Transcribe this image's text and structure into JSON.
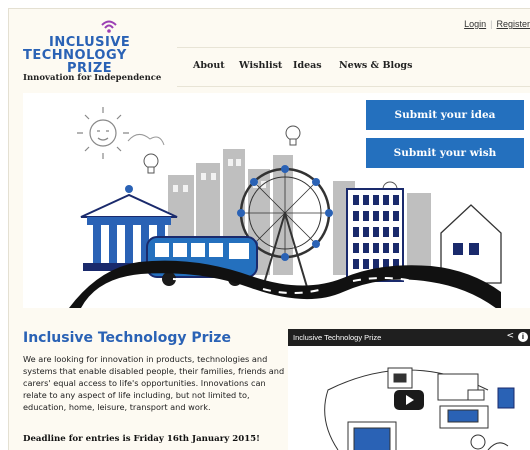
{
  "logo": {
    "line1": "INCLUSIVE",
    "line2": "TECHNOLOGY",
    "line3": "PRIZE",
    "tagline": "Innovation for Independence"
  },
  "account": {
    "login": "Login",
    "register": "Register"
  },
  "nav": {
    "items": [
      "About",
      "Wishlist",
      "Ideas",
      "News & Blogs"
    ]
  },
  "hero": {
    "submit_idea": "Submit your idea",
    "submit_wish": "Submit your wish"
  },
  "section": {
    "title": "Inclusive Technology Prize",
    "body": "We are looking for innovation in products, technologies and systems that enable disabled people, their families, friends and carers' equal access to life's opportunities. Innovations can relate to any aspect of life including, but not limited to, education, home, leisure, transport and work.",
    "deadline": "Deadline for entries is Friday 16th January 2015!"
  },
  "video": {
    "title": "Inclusive Technology Prize"
  },
  "colors": {
    "brand_blue": "#2a62b5",
    "button_blue": "#2470be",
    "page_bg": "#fdfaf2",
    "accent_purple": "#9b3fb4"
  }
}
